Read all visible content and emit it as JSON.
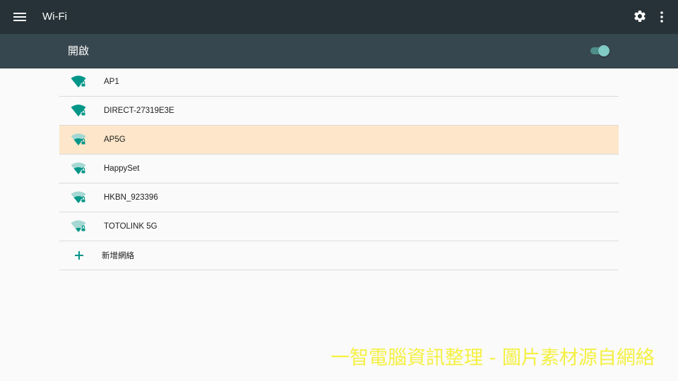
{
  "appbar": {
    "title": "Wi-Fi",
    "menu_icon": "hamburger-menu-icon",
    "settings_icon": "gear-icon",
    "more_icon": "more-vert-icon"
  },
  "wifi_switch": {
    "label": "開啟",
    "state": "on"
  },
  "networks": [
    {
      "ssid": "AP1",
      "signal_bars": 4,
      "secured": true,
      "selected": false
    },
    {
      "ssid": "DIRECT-27319E3E",
      "signal_bars": 4,
      "secured": true,
      "selected": false
    },
    {
      "ssid": "AP5G",
      "signal_bars": 2,
      "secured": true,
      "selected": true
    },
    {
      "ssid": "HappySet",
      "signal_bars": 2,
      "secured": true,
      "selected": false
    },
    {
      "ssid": "HKBN_923396",
      "signal_bars": 2,
      "secured": true,
      "selected": false
    },
    {
      "ssid": "TOTOLINK 5G",
      "signal_bars": 1,
      "secured": true,
      "selected": false
    }
  ],
  "add_network": {
    "label": "新增網絡",
    "icon": "plus-icon"
  },
  "watermark": "一智電腦資訊整理 - 圖片素材源自網絡",
  "colors": {
    "appbar": "#263238",
    "switchbar": "#37474f",
    "accent": "#009688",
    "selected_row": "#fde6c9",
    "watermark": "#f4f042"
  }
}
